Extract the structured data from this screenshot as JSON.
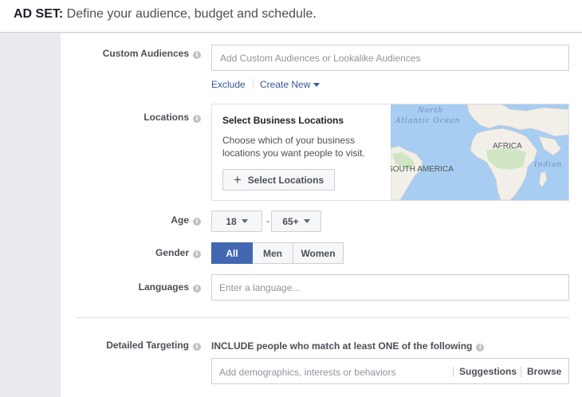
{
  "header": {
    "prefix": "AD SET:",
    "description": " Define your audience, budget and schedule",
    "period": "."
  },
  "custom_audiences": {
    "label": "Custom Audiences",
    "placeholder": "Add Custom Audiences or Lookalike Audiences",
    "exclude_link": "Exclude",
    "create_new_link": "Create New"
  },
  "locations": {
    "label": "Locations",
    "title": "Select Business Locations",
    "description": "Choose which of your business locations you want people to visit.",
    "button_label": "Select Locations",
    "map_labels": {
      "north": "North",
      "atlantic": "Atlantic Ocean",
      "africa": "AFRICA",
      "south_america": "SOUTH AMERICA",
      "indian": "Indian"
    }
  },
  "age": {
    "label": "Age",
    "min": "18",
    "separator": "-",
    "max": "65+"
  },
  "gender": {
    "label": "Gender",
    "options": [
      "All",
      "Men",
      "Women"
    ],
    "selected": "All"
  },
  "languages": {
    "label": "Languages",
    "placeholder": "Enter a language..."
  },
  "detailed_targeting": {
    "label": "Detailed Targeting",
    "include_text": "INCLUDE people who match at least ONE of the following",
    "placeholder": "Add demographics, interests or behaviors",
    "suggestions": "Suggestions",
    "browse": "Browse"
  },
  "colors": {
    "accent": "#4267b2",
    "link": "#365899",
    "ocean": "#a7cdf2",
    "land": "#f2efe9"
  }
}
